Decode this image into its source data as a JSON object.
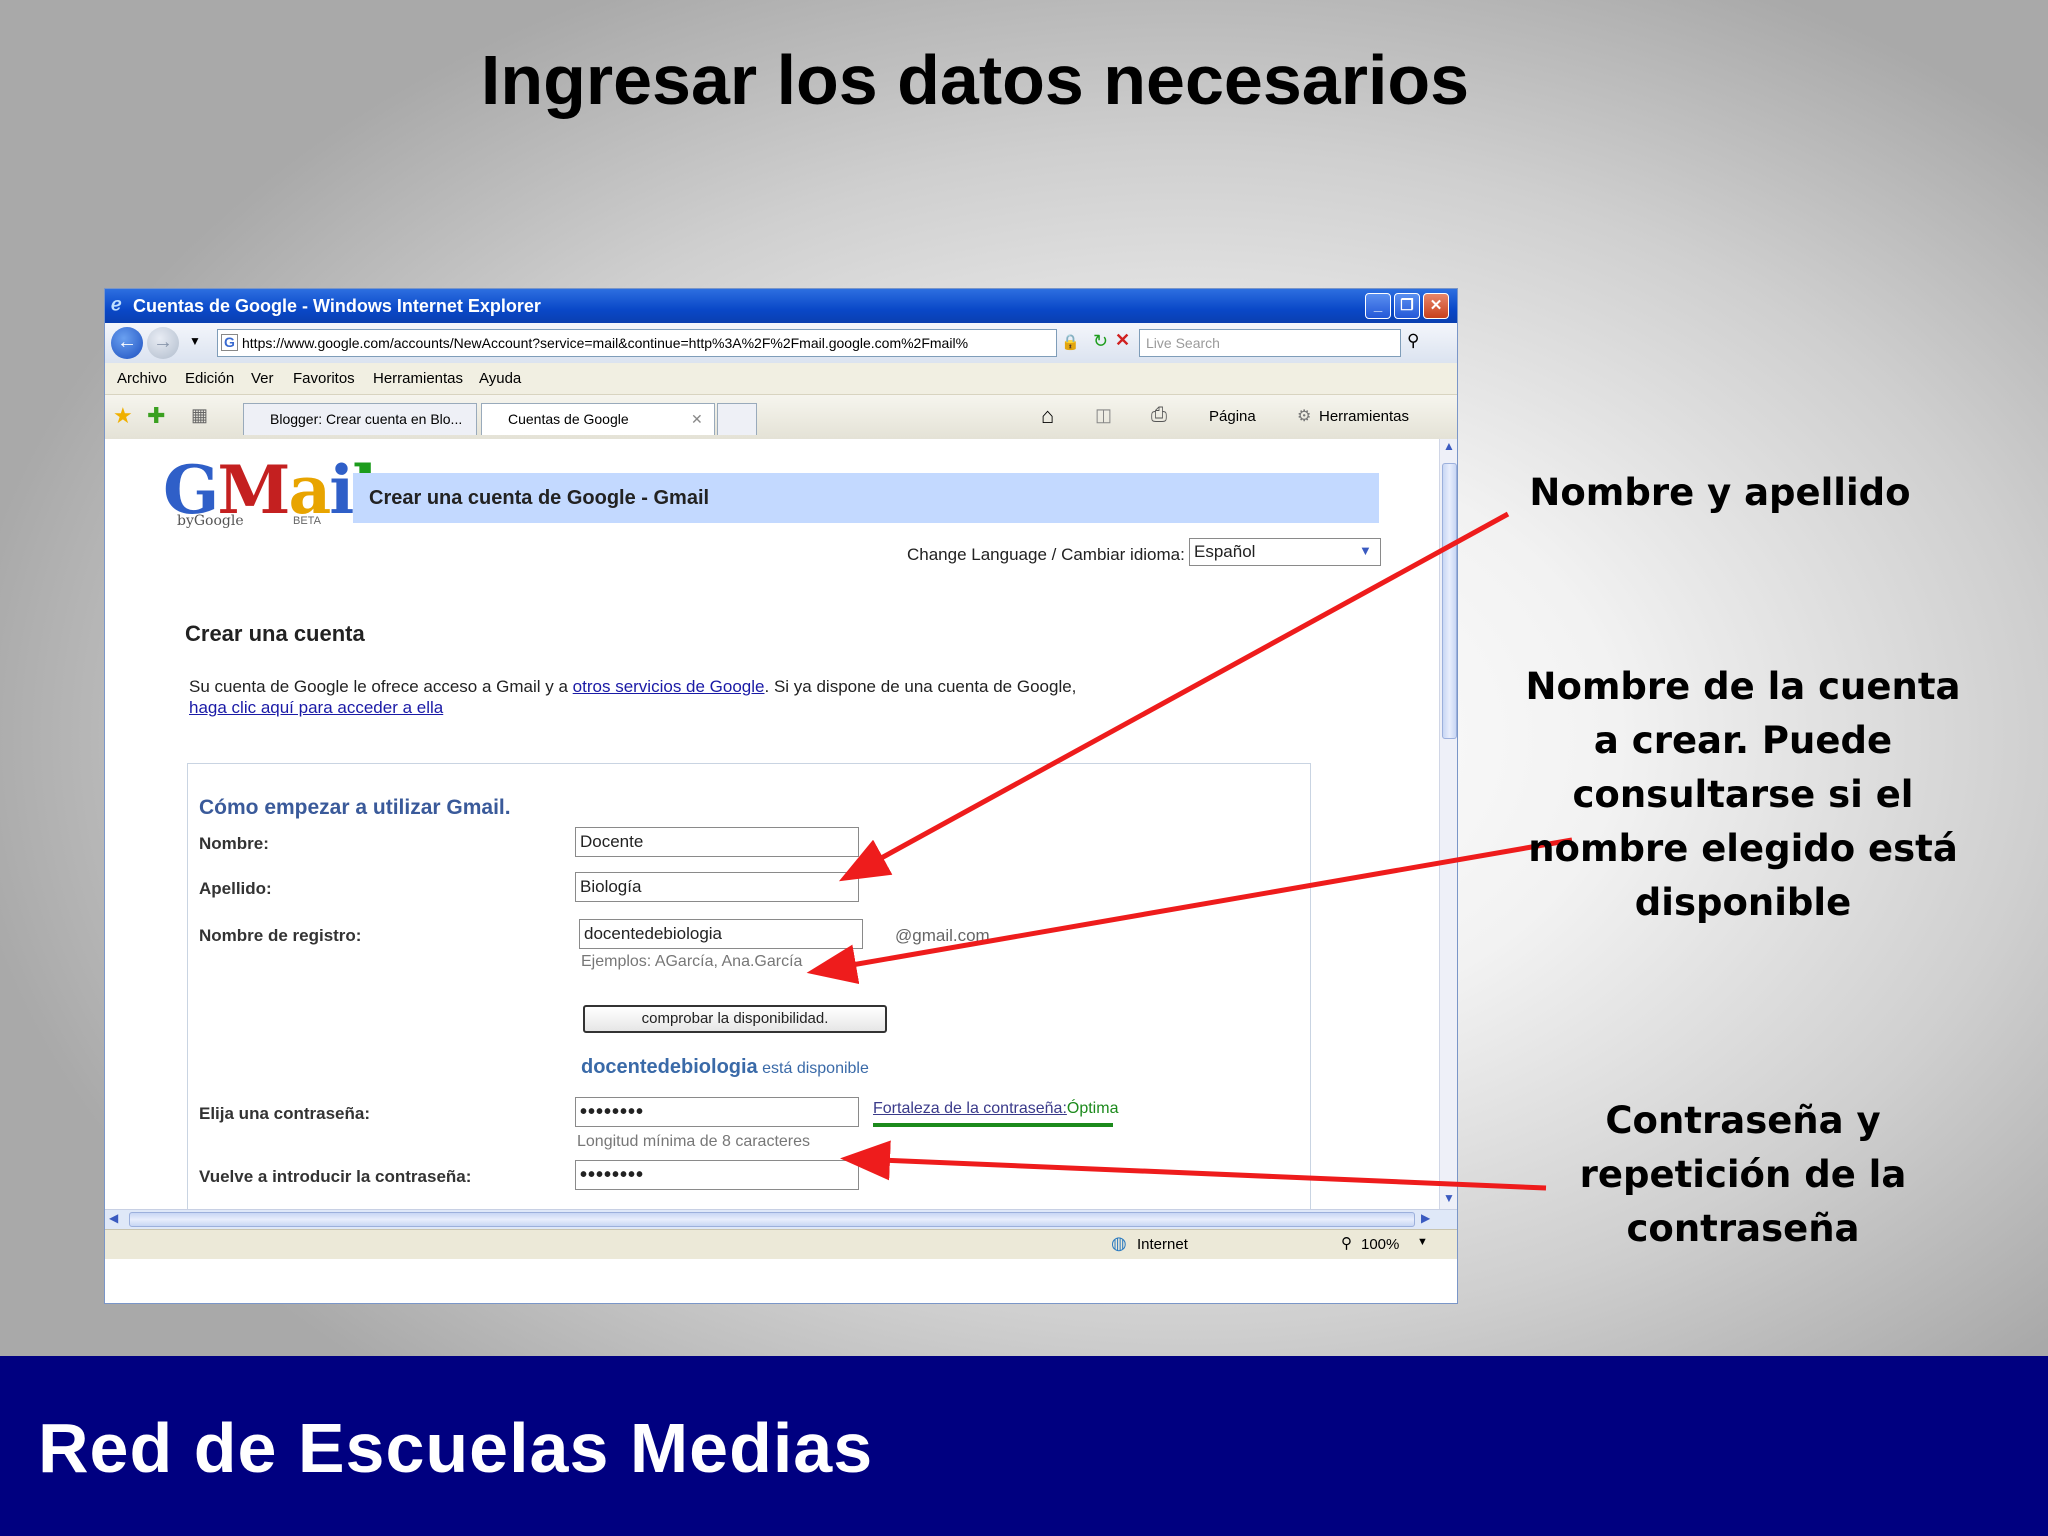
{
  "slide": {
    "title": "Ingresar los datos necesarios",
    "footer": "Red de Escuelas Medias",
    "annotations": [
      "Nombre y apellido",
      "Nombre de la cuenta a crear. Puede consultarse si el nombre elegido está disponible",
      "Contraseña y repetición de la contraseña"
    ],
    "arrow_color": "#ee1c1c"
  },
  "browser": {
    "window_title": "Cuentas de Google - Windows Internet Explorer",
    "url": "https://www.google.com/accounts/NewAccount?service=mail&continue=http%3A%2F%2Fmail.google.com%2Fmail%",
    "search_placeholder": "Live Search",
    "menu": [
      "Archivo",
      "Edición",
      "Ver",
      "Favoritos",
      "Herramientas",
      "Ayuda"
    ],
    "tabs": [
      "Blogger: Crear cuenta en Blo...",
      "Cuentas de Google"
    ],
    "toolbar_right": [
      "Página",
      "Herramientas"
    ],
    "status": {
      "zone": "Internet",
      "zoom": "100%"
    }
  },
  "page": {
    "logo_text": "Gmail",
    "logo_by": "byGoogle",
    "logo_beta": "BETA",
    "header": "Crear una cuenta de Google - Gmail",
    "language_label": "Change Language / Cambiar idioma:",
    "language_value": "Español",
    "section_title": "Crear una cuenta",
    "intro_prefix": "Su cuenta de Google le ofrece acceso a Gmail y a ",
    "intro_link": "otros servicios de Google",
    "intro_suffix": ". Si ya dispone de una cuenta de Google,",
    "login_link": "haga clic aquí para acceder a ella",
    "form_title": "Cómo empezar a utilizar Gmail.",
    "name_label": "Nombre:",
    "name_value": "Docente",
    "surname_label": "Apellido:",
    "surname_value": "Biología",
    "login_label": "Nombre de registro:",
    "login_value": "docentedebiologia",
    "domain": "@gmail.com",
    "examples": "Ejemplos: AGarcía, Ana.García",
    "check_button": "comprobar la disponibilidad.",
    "avail_name": "docentedebiologia",
    "avail_text": "está disponible",
    "password_label": "Elija una contraseña:",
    "password_value": "••••••••",
    "strength_label": "Fortaleza de la contraseña:",
    "strength_value": "Óptima",
    "min_length": "Longitud mínima de 8 caracteres",
    "confirm_label": "Vuelve a introducir la contraseña:",
    "confirm_value": "••••••••"
  }
}
